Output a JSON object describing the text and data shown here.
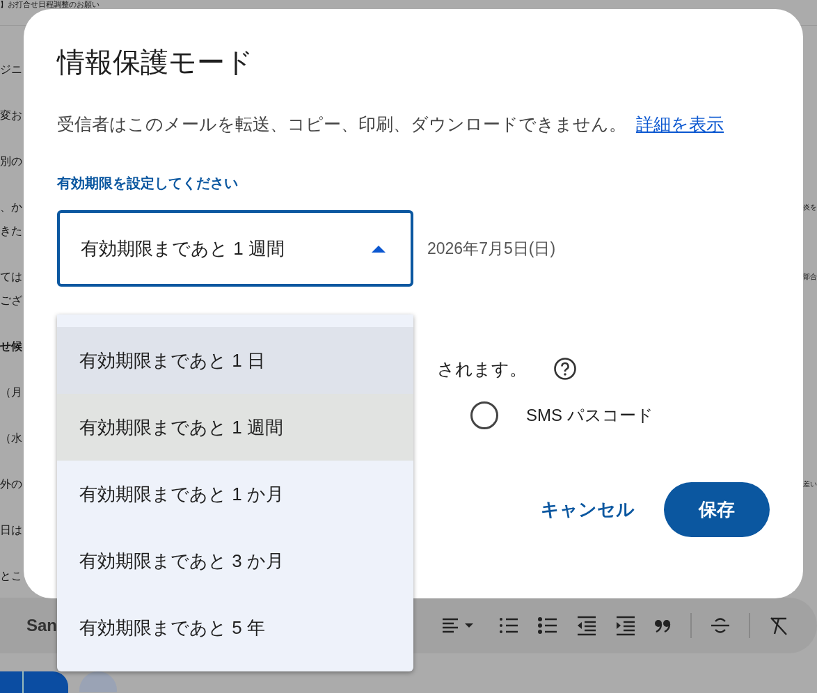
{
  "email": {
    "subject": "】お打合せ日程調整のお願い",
    "paragraphs": [
      {
        "bold": false,
        "lines": [
          {
            "start": "ジニ"
          }
        ]
      },
      {
        "bold": false,
        "lines": [
          {
            "start": "変お"
          }
        ]
      },
      {
        "bold": false,
        "lines": [
          {
            "start": "別の"
          }
        ]
      },
      {
        "bold": false,
        "lines": [
          {
            "start": "、か",
            "end": "炎を"
          },
          {
            "start": "きた"
          }
        ]
      },
      {
        "bold": false,
        "lines": [
          {
            "start": "ては",
            "end": "部合"
          },
          {
            "start": "ござ"
          }
        ]
      },
      {
        "bold": true,
        "lines": [
          {
            "start": "せ候"
          }
        ]
      },
      {
        "bold": false,
        "lines": [
          {
            "start": "（月"
          }
        ]
      },
      {
        "bold": false,
        "lines": [
          {
            "start": "（水"
          }
        ]
      },
      {
        "bold": false,
        "lines": [
          {
            "start": "外の",
            "end": "差い"
          }
        ]
      },
      {
        "bold": false,
        "lines": [
          {
            "start": "日は"
          }
        ]
      },
      {
        "bold": false,
        "lines": [
          {
            "start": "とこ"
          }
        ]
      }
    ],
    "toolbar": {
      "font_name": "San"
    }
  },
  "dialog": {
    "title": "情報保護モード",
    "description": "受信者はこのメールを転送、コピー、印刷、ダウンロードできません。",
    "learn_more_link": "詳細を表示",
    "expiry_label": "有効期限を設定してください",
    "expiry_select": {
      "value": "有効期限まであと 1 週間",
      "expanded": true
    },
    "expiry_date": "2026年7月5日(日)",
    "passcode_note": "されます。",
    "passcode_options": [
      {
        "label": "SMS パスコード",
        "selected": false
      }
    ],
    "buttons": [
      {
        "label": "キャンセル",
        "kind": "text"
      },
      {
        "label": "保存",
        "kind": "filled"
      }
    ],
    "dropdown_options": [
      {
        "label": "有効期限まであと 1 日",
        "selected": false,
        "hovered": true
      },
      {
        "label": "有効期限まであと 1 週間",
        "selected": true,
        "hovered": false
      },
      {
        "label": "有効期限まであと 1 か月",
        "selected": false,
        "hovered": false
      },
      {
        "label": "有効期限まであと 3 か月",
        "selected": false,
        "hovered": false
      },
      {
        "label": "有効期限まであと 5 年",
        "selected": false,
        "hovered": false
      }
    ]
  }
}
